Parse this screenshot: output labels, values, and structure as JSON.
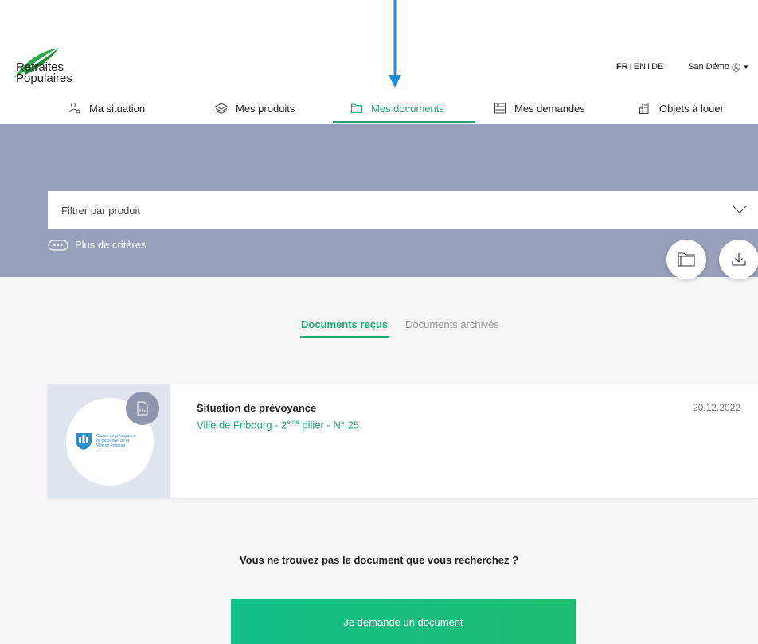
{
  "brand": {
    "line1": "Retraites",
    "line2": "Populaires",
    "leaf_color": "#2ba84a"
  },
  "header": {
    "languages": [
      {
        "label": "FR",
        "active": true
      },
      {
        "label": "EN",
        "active": false
      },
      {
        "label": "DE",
        "active": false
      }
    ],
    "separator": "I",
    "user_name": "San Démo"
  },
  "nav": {
    "items": [
      {
        "label": "Ma situation",
        "icon": "person-search-icon"
      },
      {
        "label": "Mes produits",
        "icon": "layers-icon"
      },
      {
        "label": "Mes documents",
        "icon": "folder-icon",
        "active": true
      },
      {
        "label": "Mes demandes",
        "icon": "requests-icon"
      },
      {
        "label": "Objets à louer",
        "icon": "building-icon"
      }
    ]
  },
  "filter": {
    "placeholder": "Filtrer par produit",
    "more_criteria": "Plus de critères"
  },
  "tabs": {
    "received": "Documents reçus",
    "archived": "Documents archivés"
  },
  "document": {
    "title": "Situation de prévoyance",
    "subtitle_pre": "Ville de Fribourg - 2",
    "subtitle_sup": "ème",
    "subtitle_post": " pilier - N° 25",
    "date": "20.12.2022",
    "issuer_line1": "Caisse de prévoyance",
    "issuer_line2": "du personnel de la",
    "issuer_line3": "Ville de Fribourg"
  },
  "help": {
    "question": "Vous ne trouvez pas le document que vous recherchez ?",
    "cta_label": "Je demande un document"
  },
  "colors": {
    "accent": "#1fa873",
    "band": "#98a1bb",
    "arrow": "#1d8fd8"
  }
}
